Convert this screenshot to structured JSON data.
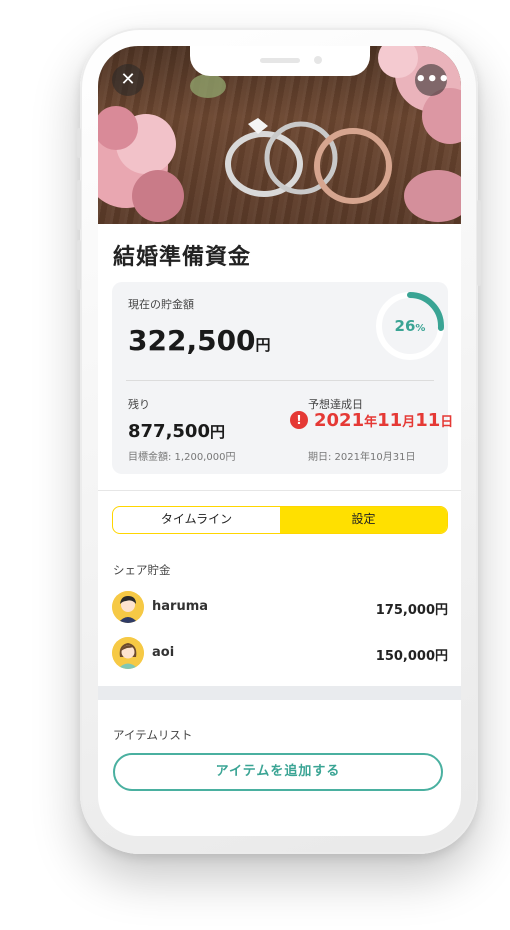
{
  "hero": {
    "close_icon": "close-icon",
    "more_icon": "more-horizontal-icon"
  },
  "goal": {
    "title": "結婚準備資金",
    "current_label": "現在の貯金額",
    "current_amount": "322,500",
    "currency_unit": "円",
    "progress_percent": 26,
    "progress_text": "26",
    "percent_sign": "%",
    "remaining_label": "残り",
    "remaining_amount": "877,500",
    "target_text": "目標金額: 1,200,000円",
    "forecast_label": "予想達成日",
    "forecast_year": "2021",
    "forecast_year_unit": "年",
    "forecast_month": "11",
    "forecast_month_unit": "月",
    "forecast_day": "11",
    "forecast_day_unit": "日",
    "deadline_text": "期日: 2021年10月31日",
    "accent_color": "#3aa494",
    "alert_color": "#e53935"
  },
  "tabs": [
    {
      "label": "タイムライン",
      "active": false
    },
    {
      "label": "設定",
      "active": true
    }
  ],
  "share": {
    "label": "シェア貯金",
    "members": [
      {
        "name": "haruma",
        "amount": "175,000円"
      },
      {
        "name": "aoi",
        "amount": "150,000円"
      }
    ]
  },
  "items": {
    "label": "アイテムリスト",
    "add_button": "アイテムを追加する"
  }
}
